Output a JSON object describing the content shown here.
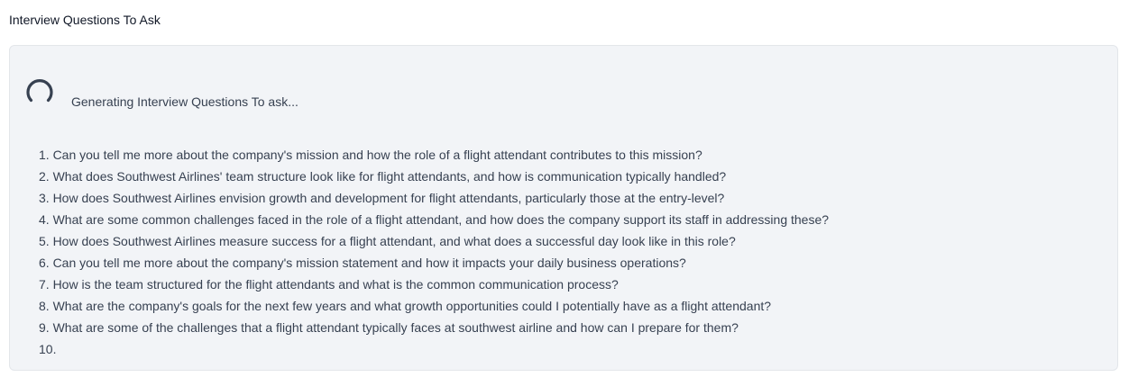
{
  "page": {
    "title": "Interview Questions To Ask"
  },
  "status": {
    "text": "Generating Interview Questions To ask...",
    "icon": "loading-spinner-icon"
  },
  "questions": [
    "1. Can you tell me more about the company's mission and how the role of a flight attendant contributes to this mission?",
    "2. What does Southwest Airlines' team structure look like for flight attendants, and how is communication typically handled?",
    "3. How does Southwest Airlines envision growth and development for flight attendants, particularly those at the entry-level?",
    "4. What are some common challenges faced in the role of a flight attendant, and how does the company support its staff in addressing these?",
    "5. How does Southwest Airlines measure success for a flight attendant, and what does a successful day look like in this role?",
    "6. Can you tell me more about the company's mission statement and how it impacts your daily business operations?",
    "7. How is the team structured for the flight attendants and what is the common communication process?",
    "8. What are the company's goals for the next few years and what growth opportunities could I potentially have as a flight attendant?",
    "9. What are some of the challenges that a flight attendant typically faces at southwest airline and how can I prepare for them?",
    "10."
  ],
  "colors": {
    "panel_background": "#f2f4f7",
    "panel_border": "#e3e6ea",
    "text": "#374151",
    "title": "#111827",
    "spinner": "#374151"
  }
}
